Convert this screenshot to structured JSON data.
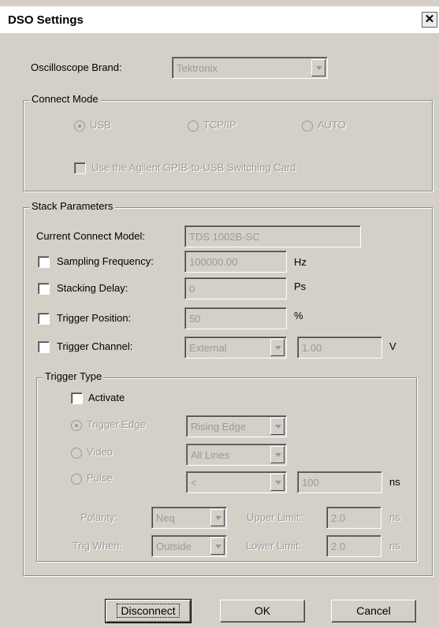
{
  "window": {
    "title": "DSO Settings",
    "close_glyph": "✕"
  },
  "brand": {
    "label": "Oscilloscope Brand:",
    "value": "Tektronix"
  },
  "connect_mode": {
    "legend": "Connect Mode",
    "usb": "USB",
    "tcpip": "TCP/IP",
    "auto": "AUTO",
    "selected": "USB",
    "agilent_label": "Use the Agilent GPIB-to-USB Switching Card"
  },
  "stack": {
    "legend": "Stack Parameters",
    "current_model_label": "Current Connect Model:",
    "current_model_value": "TDS 1002B-SC",
    "sampling_label": "Sampling Frequency:",
    "sampling_value": "100000.00",
    "sampling_unit": "Hz",
    "stacking_label": "Stacking Delay:",
    "stacking_value": "0",
    "stacking_unit": "Ps",
    "trigger_pos_label": "Trigger Position:",
    "trigger_pos_value": "50",
    "trigger_pos_unit": "%",
    "trigger_ch_label": "Trigger Channel:",
    "trigger_ch_value": "External",
    "trigger_level_value": "1.00",
    "trigger_level_unit": "V"
  },
  "trigger_type": {
    "legend": "Trigger Type",
    "activate_label": "Activate",
    "edge_label": "Trigger Edge",
    "edge_value": "Rising Edge",
    "video_label": "Video",
    "video_value": "All Lines",
    "pulse_label": "Pulse",
    "pulse_value": "<",
    "pulse_width_value": "100",
    "pulse_width_unit": "ns",
    "polarity_label": "Polarity:",
    "polarity_value": "Neq",
    "upper_label": "Upper Limit:",
    "upper_value": "2.0",
    "upper_unit": "ns",
    "trig_when_label": "Trig When:",
    "trig_when_value": "Outside",
    "lower_label": "Lower Limit:",
    "lower_value": "2.0",
    "lower_unit": "ns"
  },
  "buttons": {
    "disconnect": "Disconnect",
    "ok": "OK",
    "cancel": "Cancel"
  }
}
